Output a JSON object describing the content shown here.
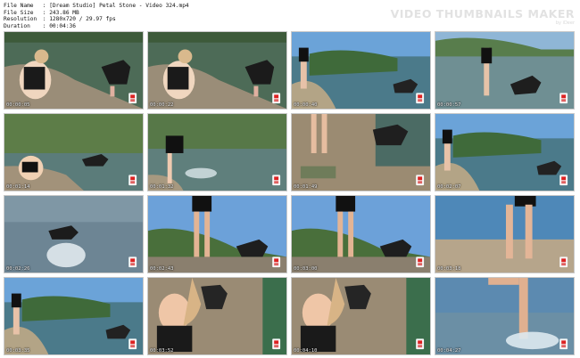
{
  "file_info": {
    "file_name_label": "File Name",
    "file_name_value": "[Dream Studio] Petal Stone - Video 324.mp4",
    "file_size_label": "File Size",
    "file_size_value": "243.86 MB",
    "resolution_label": "Resolution",
    "resolution_value": "1280x720 / 29.97 fps",
    "duration_label": "Duration",
    "duration_value": "00:04:36"
  },
  "brand": {
    "title": "VIDEO THUMBNAILS MAKER",
    "subtitle": "by iDeer"
  },
  "thumbnails": [
    {
      "timestamp": "00:00:05",
      "scene": "beach-crouch-dog"
    },
    {
      "timestamp": "00:00:22",
      "scene": "beach-crouch-dog"
    },
    {
      "timestamp": "00:00:40",
      "scene": "shore-stand-dog"
    },
    {
      "timestamp": "00:00:57",
      "scene": "water-walk-dog"
    },
    {
      "timestamp": "00:01:14",
      "scene": "reeds-crouch-dog"
    },
    {
      "timestamp": "00:01:32",
      "scene": "reeds-bend-splash"
    },
    {
      "timestamp": "00:01:49",
      "scene": "legs-dog-shore"
    },
    {
      "timestamp": "00:02:07",
      "scene": "shore-stand-dog"
    },
    {
      "timestamp": "00:02:26",
      "scene": "dog-swimming"
    },
    {
      "timestamp": "00:02:43",
      "scene": "legs-dog-sky"
    },
    {
      "timestamp": "00:03:00",
      "scene": "legs-dog-sky"
    },
    {
      "timestamp": "00:03:18",
      "scene": "legs-water"
    },
    {
      "timestamp": "00:03:35",
      "scene": "shore-stand-dog"
    },
    {
      "timestamp": "00:03:52",
      "scene": "closeup-girl-dog"
    },
    {
      "timestamp": "00:04:10",
      "scene": "closeup-girl-dog"
    },
    {
      "timestamp": "00:04:27",
      "scene": "legs-water-splash"
    }
  ]
}
